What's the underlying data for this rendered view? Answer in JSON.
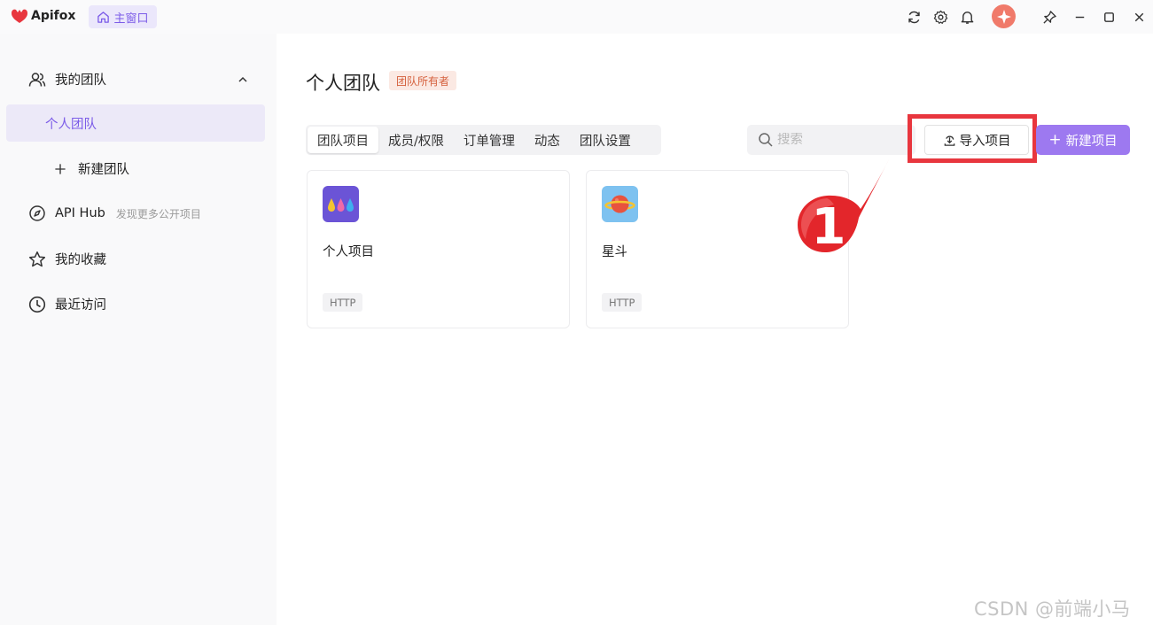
{
  "titlebar": {
    "app_name": "Apifox",
    "home_tab": "主窗口",
    "icons": [
      "refresh-icon",
      "settings-icon",
      "bell-icon",
      "avatar",
      "pin-icon",
      "minimize-icon",
      "maximize-icon",
      "close-icon"
    ]
  },
  "sidebar": {
    "my_team": "我的团队",
    "personal_team": "个人团队",
    "new_team": "新建团队",
    "api_hub": "API Hub",
    "api_hub_sub": "发现更多公开项目",
    "favorites": "我的收藏",
    "recent": "最近访问"
  },
  "main": {
    "title": "个人团队",
    "owner_badge": "团队所有者",
    "tabs": [
      "团队项目",
      "成员/权限",
      "订单管理",
      "动态",
      "团队设置"
    ],
    "search_placeholder": "搜索",
    "import_button": "导入项目",
    "new_button": "新建项目",
    "projects": [
      {
        "name": "个人项目",
        "tag": "HTTP"
      },
      {
        "name": "星斗",
        "tag": "HTTP"
      }
    ]
  },
  "annotation": {
    "number": "1"
  },
  "watermark": "CSDN @前端小马",
  "colors": {
    "accent": "#9d79f0",
    "accent_text": "#7b5be8",
    "highlight_red": "#e8363e",
    "badge_bg": "#fbe9e3",
    "badge_text": "#d5603c"
  }
}
